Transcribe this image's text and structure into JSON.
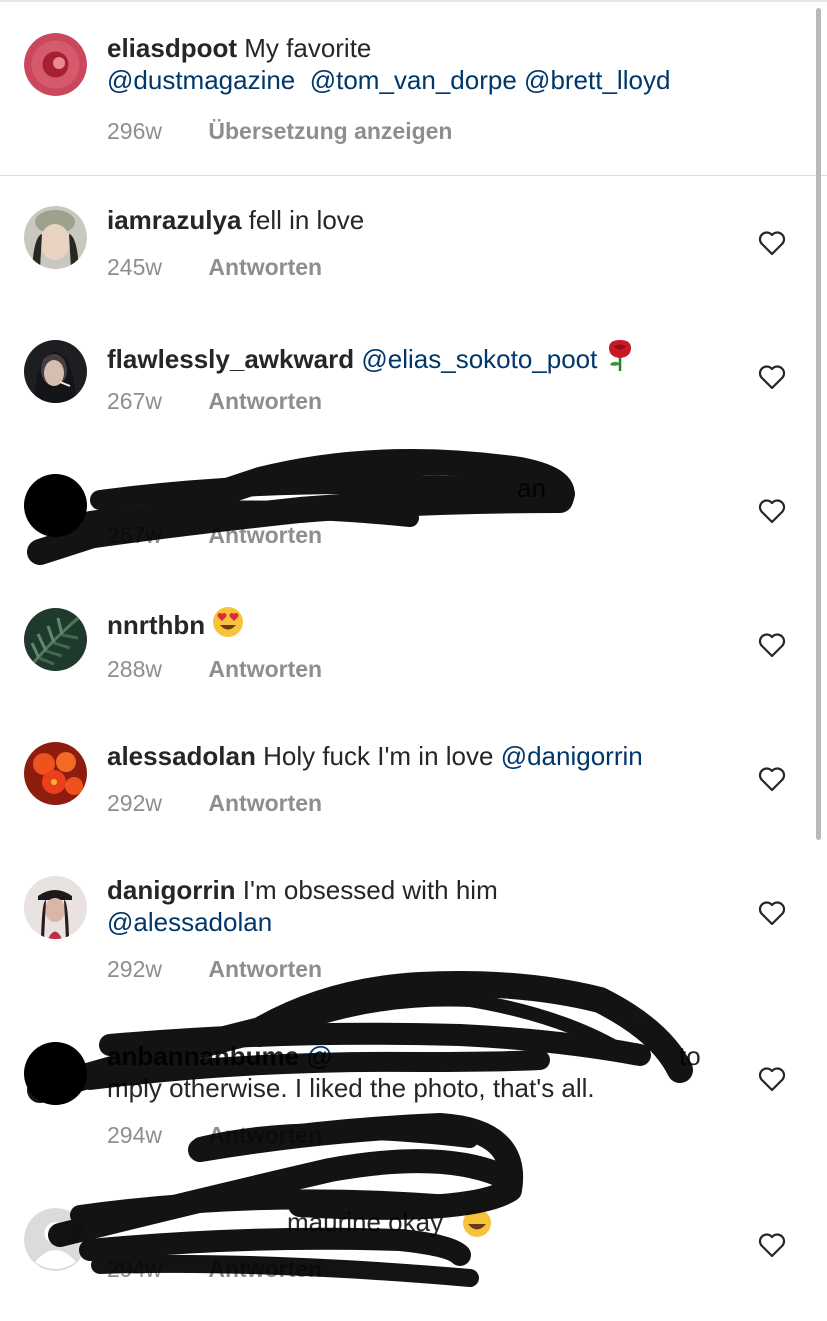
{
  "caption": {
    "username": "eliasdpoot",
    "text": "My favorite",
    "mentions": [
      "@dustmagazine",
      "@tom_van_dorpe",
      "@brett_lloyd"
    ],
    "time": "296w",
    "translate_label": "Übersetzung anzeigen"
  },
  "comments": [
    {
      "username": "iamrazulya",
      "text": "fell in love",
      "time": "245w",
      "reply_label": "Antworten"
    },
    {
      "username": "flawlessly_awkward",
      "mention": "@elias_sokoto_poot",
      "emoji": "rose",
      "time": "267w",
      "reply_label": "Antworten"
    },
    {
      "username": "",
      "text": "an",
      "time": "267w",
      "reply_label": "Antworten"
    },
    {
      "username": "nnrthbn",
      "emoji": "heart-eyes",
      "time": "288w",
      "reply_label": "Antworten"
    },
    {
      "username": "alessadolan",
      "text": "Holy fuck I'm in love",
      "mention": "@danigorrin",
      "time": "292w",
      "reply_label": "Antworten"
    },
    {
      "username": "danigorrin",
      "text": "I'm obsessed with him",
      "mention": "@alessadolan",
      "time": "292w",
      "reply_label": "Antworten"
    },
    {
      "username": "anbannanbume",
      "mention": "@",
      "text_end": "to",
      "text_line2": "mply otherwise. I liked the photo, that's all.",
      "time": "294w",
      "reply_label": "Antworten"
    },
    {
      "username": "",
      "text": "maurine okay",
      "emoji": "laughing",
      "time": "294w",
      "reply_label": "Antworten"
    }
  ]
}
